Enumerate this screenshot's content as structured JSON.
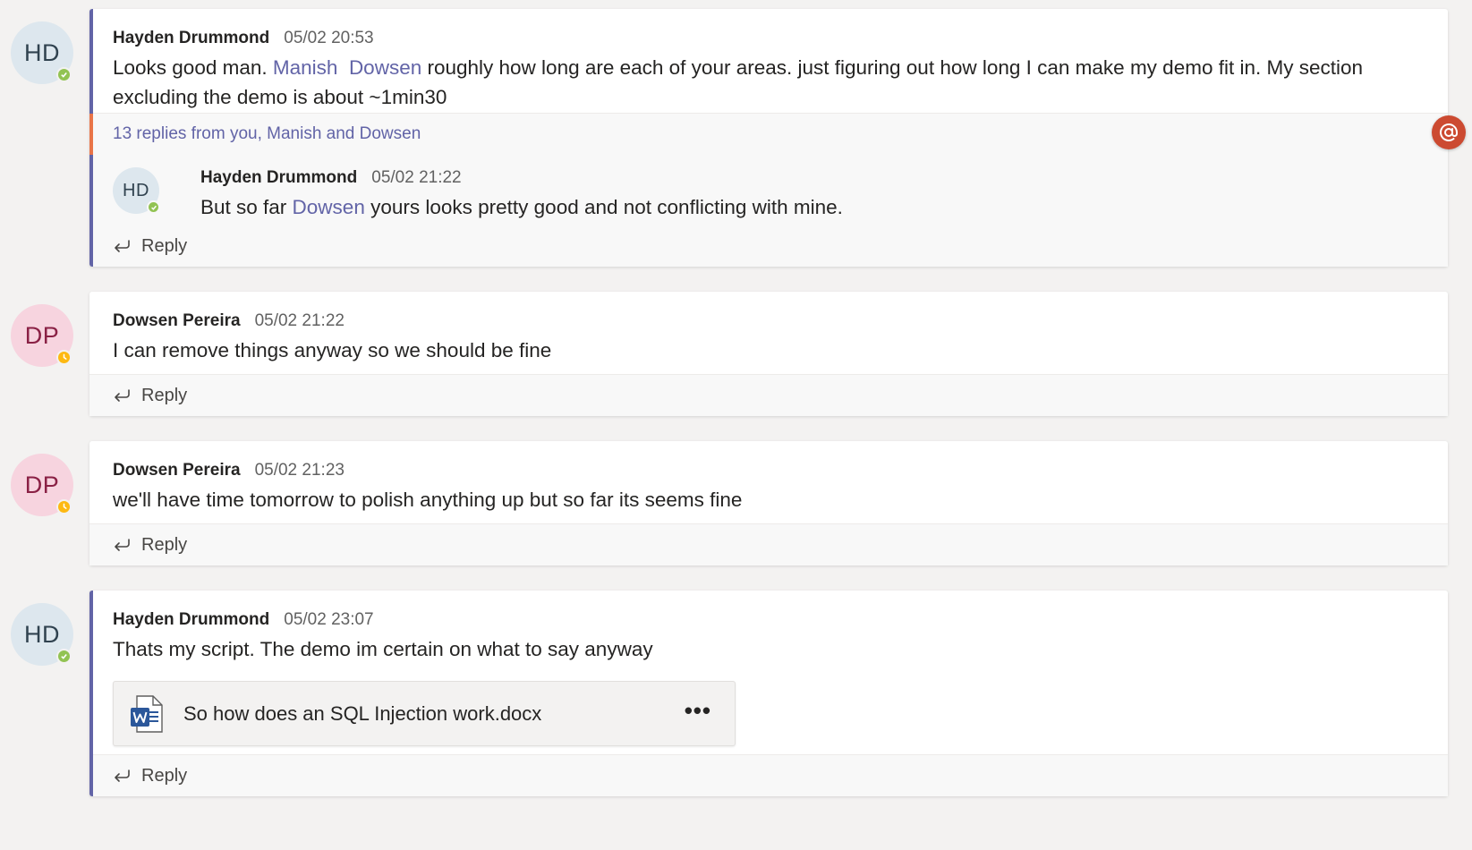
{
  "colors": {
    "accent": "#6264a7",
    "available": "#92c353",
    "away": "#fdb913",
    "mention_badge": "#cc4a31",
    "unread_bar": "#e97548"
  },
  "reply_label": "Reply",
  "messages": [
    {
      "avatar_initials": "HD",
      "author": "Hayden Drummond",
      "timestamp": "05/02 20:53",
      "text_parts": {
        "before": "Looks good man. ",
        "mention1": "Manish",
        "sep": "  ",
        "mention2": "Dowsen",
        "after": " roughly how long are each of your areas. just figuring out how long I can make my demo fit in. My section excluding the demo is about ~1min30"
      },
      "replies_summary": "13 replies from you, Manish and Dowsen",
      "mention_icon": "at-icon",
      "nested_reply": {
        "avatar_initials": "HD",
        "author": "Hayden Drummond",
        "timestamp": "05/02 21:22",
        "text_before": "But so far ",
        "mention": "Dowsen",
        "text_after": " yours looks pretty good and not conflicting with mine."
      }
    },
    {
      "avatar_initials": "DP",
      "author": "Dowsen Pereira",
      "timestamp": "05/02 21:22",
      "text": "I can remove things anyway so we should be fine"
    },
    {
      "avatar_initials": "DP",
      "author": "Dowsen Pereira",
      "timestamp": "05/02 21:23",
      "text": "we'll have time tomorrow to polish anything up but so far its seems fine"
    },
    {
      "avatar_initials": "HD",
      "author": "Hayden Drummond",
      "timestamp": "05/02 23:07",
      "text": "Thats my script. The demo im certain on what to say anyway",
      "attachment": {
        "icon": "word-doc-icon",
        "name": "So how does an SQL Injection work.docx",
        "more_label": "•••"
      }
    }
  ]
}
